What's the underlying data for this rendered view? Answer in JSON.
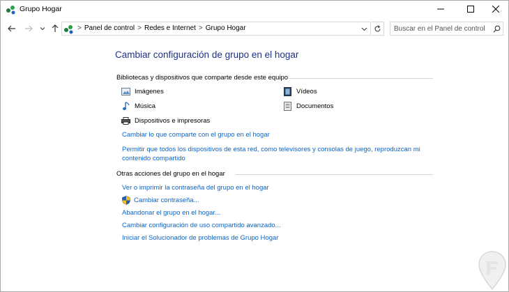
{
  "window": {
    "title": "Grupo Hogar",
    "minimize": "—",
    "maximize": "☐",
    "close": "✕"
  },
  "nav": {
    "back": "←",
    "forward": "→",
    "recent": "⌄",
    "up": "↑",
    "breadcrumbs": [
      "Panel de control",
      "Redes e Internet",
      "Grupo Hogar"
    ],
    "separator": ">",
    "search_placeholder": "Buscar en el Panel de control"
  },
  "main": {
    "title": "Cambiar configuración de grupo en el hogar",
    "shared_section": {
      "heading": "Bibliotecas y dispositivos que comparte desde este equipo",
      "items": [
        {
          "label": "Imágenes",
          "icon": "pictures-library-icon"
        },
        {
          "label": "Vídeos",
          "icon": "videos-library-icon"
        },
        {
          "label": "Música",
          "icon": "music-library-icon"
        },
        {
          "label": "Documentos",
          "icon": "documents-library-icon"
        },
        {
          "label": "Dispositivos e impresoras",
          "icon": "printer-icon"
        }
      ],
      "links": [
        "Cambiar lo que comparte con el grupo en el hogar",
        "Permitir que todos los dispositivos de esta red, como televisores y consolas de juego, reproduzcan mi contenido compartido"
      ]
    },
    "other_section": {
      "heading": "Otras acciones del grupo en el hogar",
      "links": [
        "Ver o imprimir la contraseña del grupo en el hogar",
        "Cambiar contraseña...",
        "Abandonar el grupo en el hogar...",
        "Cambiar configuración de uso compartido avanzado...",
        "Iniciar el Solucionador de problemas de Grupo Hogar"
      ]
    }
  },
  "colors": {
    "title_blue": "#1e3287",
    "link_blue": "#0a64c8",
    "divider": "#d5d5d5"
  }
}
